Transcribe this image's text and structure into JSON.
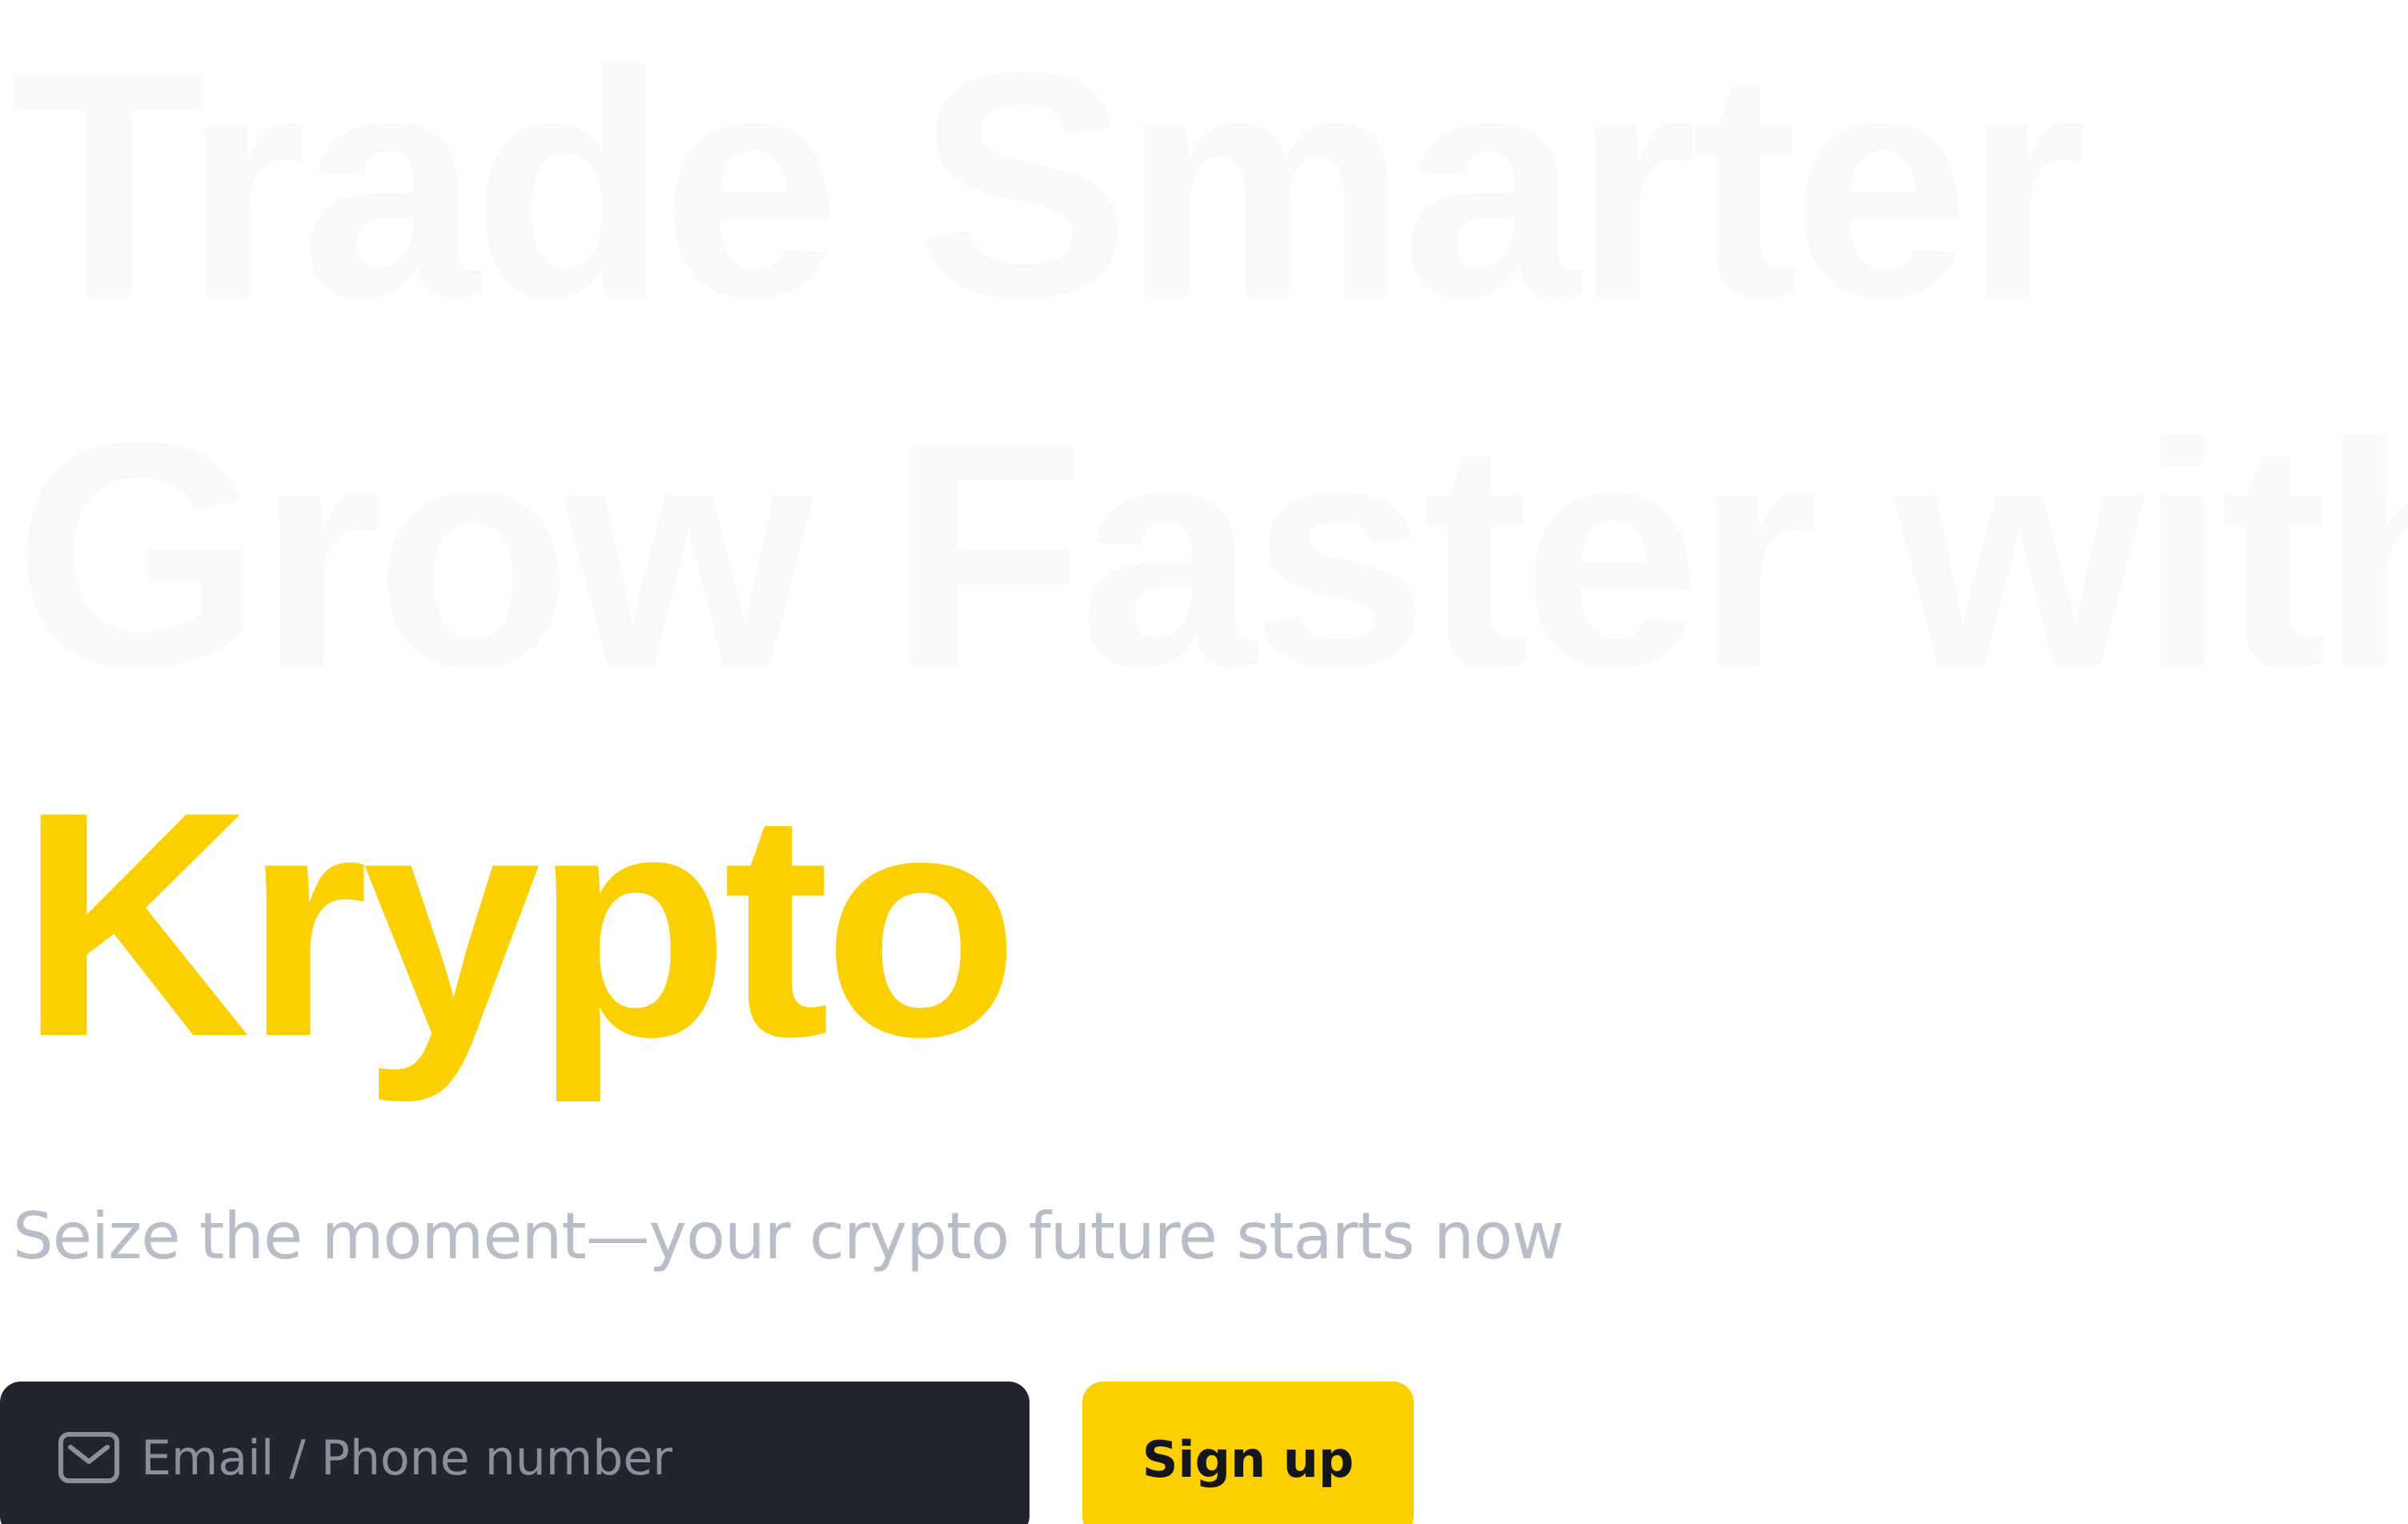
{
  "hero": {
    "headline_line1": "Trade Smarter",
    "headline_line2": "Grow Faster with",
    "headline_line3": "Krypto",
    "subtitle": "Seize the moment—your crypto future starts now"
  },
  "signup": {
    "placeholder": "Email / Phone number",
    "value": "",
    "button_label": "Sign up",
    "input_icon": "mail-icon"
  },
  "colors": {
    "accent": "#fcd000",
    "muted_headline": "#f9f9fa",
    "subtitle": "#b7bdc9",
    "input_background": "#23252e",
    "placeholder": "#8a8f9c"
  }
}
